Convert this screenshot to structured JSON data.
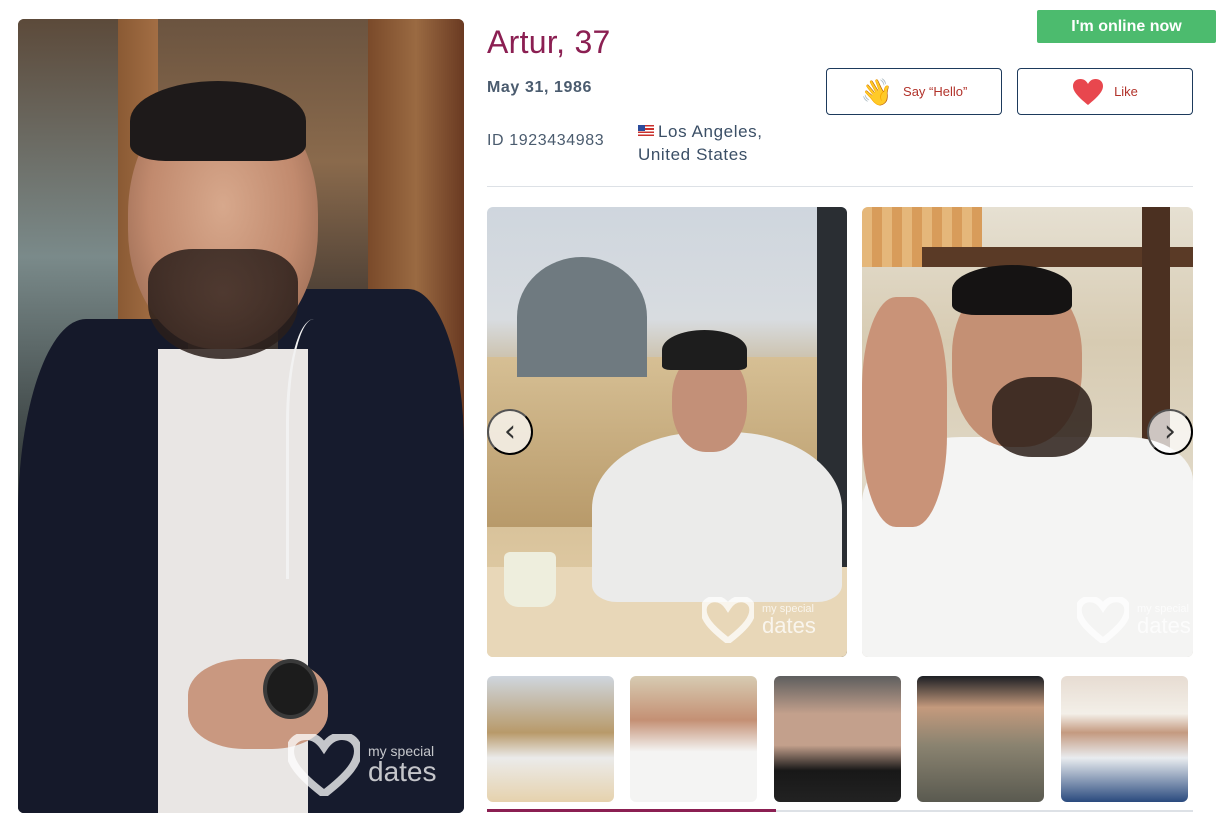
{
  "profile": {
    "name_age": "Artur, 37",
    "birth_date": "May 31, 1986",
    "id_label": "ID 1923434983",
    "location_line1": "Los Angeles,",
    "location_line2": "United States",
    "flag_icon": "us-flag-icon"
  },
  "status": {
    "online_label": "I'm online now",
    "online_color": "#4cbb6e"
  },
  "actions": {
    "hello_label": "Say “Hello”",
    "hello_icon": "waving-hand-icon",
    "like_label": "Like",
    "like_icon": "heart-icon"
  },
  "watermark": {
    "line1": "my special",
    "line2": "dates"
  },
  "gallery": {
    "photos_visible": 2,
    "prev_icon": "chevron-left-icon",
    "next_icon": "chevron-right-icon",
    "prev_glyph": "‹",
    "next_glyph": "›"
  },
  "thumbnails": {
    "count": 5,
    "progress_fraction": 0.41
  },
  "colors": {
    "name": "#8b1f52",
    "accent": "#8b1f52",
    "button_border": "#1d3a5c",
    "button_text": "#b2332b"
  }
}
